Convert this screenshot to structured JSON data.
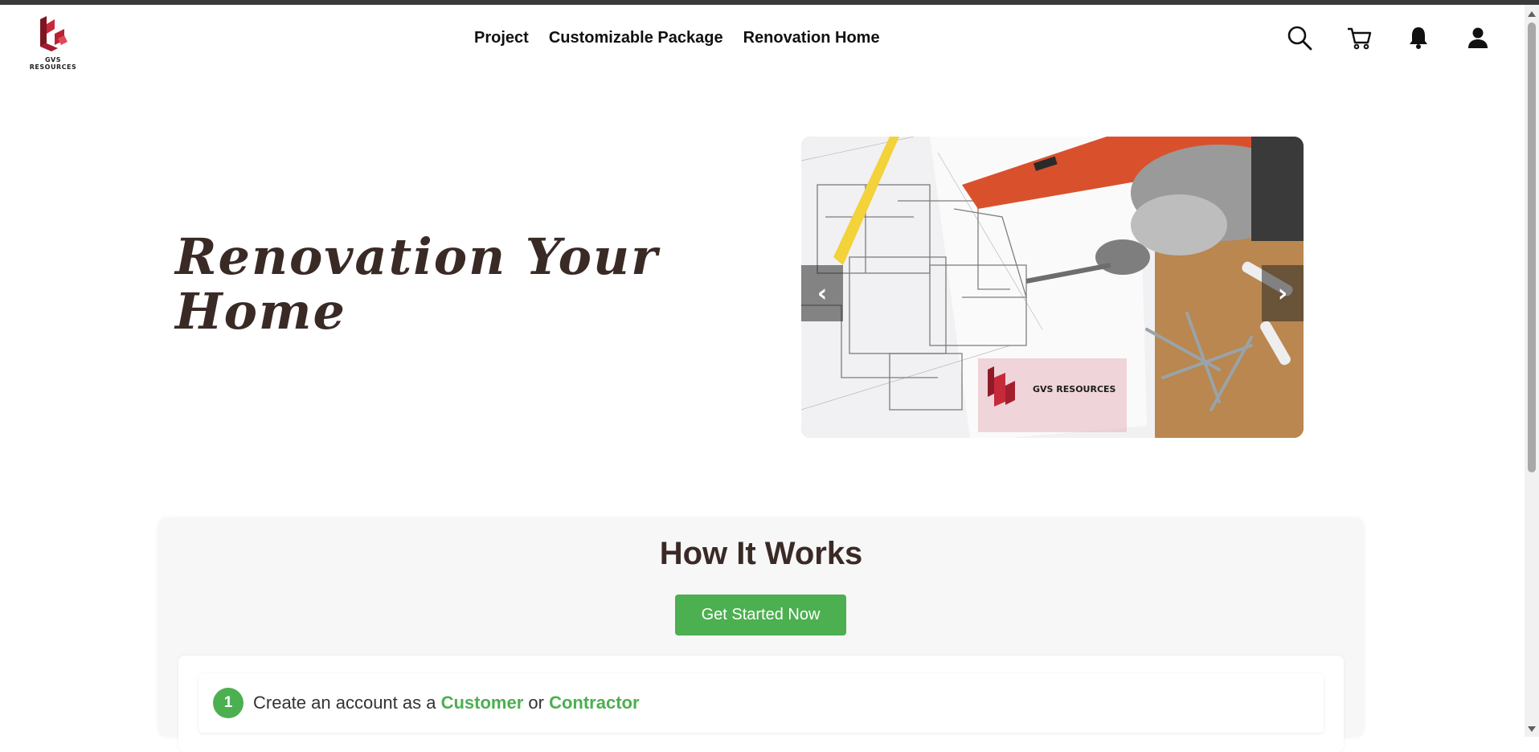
{
  "brand": {
    "logo_text": "GVS RESOURCES",
    "accent": "#c62a3a",
    "green": "#4caf50"
  },
  "nav": {
    "items": [
      {
        "label": "Project"
      },
      {
        "label": "Customizable Package"
      },
      {
        "label": "Renovation Home"
      }
    ]
  },
  "header_icons": [
    "search-icon",
    "cart-icon",
    "bell-icon",
    "user-icon"
  ],
  "hero": {
    "title": "Renovation Your Home",
    "carousel": {
      "prev_label": "‹",
      "next_label": "›",
      "watermark": "GVS RESOURCES"
    }
  },
  "how": {
    "title": "How It Works",
    "cta_label": "Get Started Now",
    "steps": [
      {
        "number": "1",
        "prefix": "Create an account as a ",
        "link1": "Customer",
        "middle": " or ",
        "link2": "Contractor"
      }
    ]
  }
}
